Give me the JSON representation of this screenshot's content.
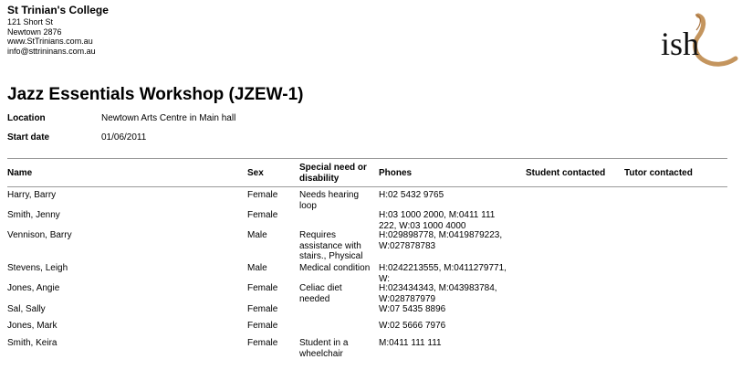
{
  "college": {
    "name": "St Trinian's College",
    "address1": "121 Short St",
    "address2": "Newtown 2876",
    "website": "www.StTrinians.com.au",
    "email": "info@sttrininans.com.au"
  },
  "logo": {
    "text": "ish",
    "accent": "#c4955e"
  },
  "title": "Jazz Essentials Workshop (JZEW-1)",
  "details": {
    "location_label": "Location",
    "location_value": "Newtown Arts Centre in Main hall",
    "start_label": "Start date",
    "start_value": "01/06/2011"
  },
  "table": {
    "headers": {
      "name": "Name",
      "sex": "Sex",
      "special_1": "Special need or",
      "special_2": "disability",
      "phones": "Phones",
      "student_contacted": "Student contacted",
      "tutor_contacted": "Tutor contacted"
    },
    "rows": [
      {
        "name": "Harry, Barry",
        "sex": "Female",
        "special": [
          "Needs hearing",
          "loop"
        ],
        "phones": [
          "H:02 5432 9765"
        ]
      },
      {
        "name": "Smith, Jenny",
        "sex": "Female",
        "special": [],
        "phones": [
          "H:03 1000 2000, M:0411 111",
          "222, W:03 1000 4000"
        ]
      },
      {
        "name": "Vennison, Barry",
        "sex": "Male",
        "special": [
          "Requires",
          "assistance with",
          "stairs., Physical"
        ],
        "phones": [
          "H:029898778, M:0419879223,",
          "W:027878783"
        ]
      },
      {
        "name": "Stevens, Leigh",
        "sex": "Male",
        "special": [
          "Medical condition"
        ],
        "phones": [
          "H:0242213555, M:0411279771,",
          "W:"
        ]
      },
      {
        "name": "Jones, Angie",
        "sex": "Female",
        "special": [
          "Celiac diet",
          "needed"
        ],
        "phones": [
          "H:023434343, M:043983784,",
          "W:028787979"
        ]
      },
      {
        "name": "Sal, Sally",
        "sex": "Female",
        "special": [],
        "phones": [
          "W:07 5435 8896"
        ]
      },
      {
        "name": "Jones, Mark",
        "sex": "Female",
        "special": [],
        "phones": [
          "W:02 5666 7976"
        ]
      },
      {
        "name": "Smith, Keira",
        "sex": "Female",
        "special": [
          "Student in a",
          "wheelchair"
        ],
        "phones": [
          "M:0411 111 111"
        ]
      }
    ]
  }
}
